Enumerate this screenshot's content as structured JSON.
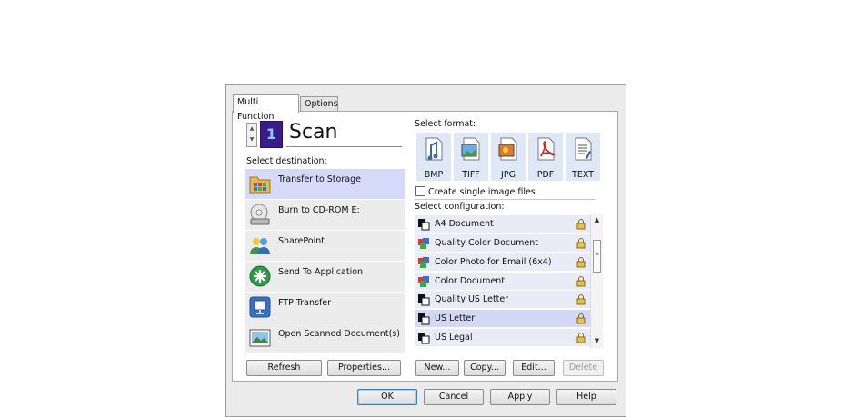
{
  "tabs": [
    {
      "label": "Multi Function"
    },
    {
      "label": "Options"
    }
  ],
  "scan": {
    "counter": "1",
    "title": "Scan"
  },
  "destination": {
    "label": "Select destination:",
    "items": [
      {
        "label": "Transfer to Storage",
        "icon": "folder-storage-icon",
        "selected": true
      },
      {
        "label": "Burn to CD-ROM  E:",
        "icon": "cd-drive-icon",
        "selected": false
      },
      {
        "label": "SharePoint",
        "icon": "sharepoint-icon",
        "selected": false
      },
      {
        "label": "Send To Application",
        "icon": "send-application-icon",
        "selected": false
      },
      {
        "label": "FTP Transfer",
        "icon": "ftp-icon",
        "selected": false
      },
      {
        "label": "Open Scanned Document(s)",
        "icon": "open-document-icon",
        "selected": false
      }
    ],
    "buttons": {
      "refresh": "Refresh",
      "properties": "Properties..."
    }
  },
  "format": {
    "label": "Select format:",
    "items": [
      {
        "label": "BMP",
        "icon": "bmp-icon"
      },
      {
        "label": "TIFF",
        "icon": "tiff-icon"
      },
      {
        "label": "JPG",
        "icon": "jpg-icon"
      },
      {
        "label": "PDF",
        "icon": "pdf-icon"
      },
      {
        "label": "TEXT",
        "icon": "text-icon"
      }
    ],
    "single_files_label": "Create single image files",
    "single_files_checked": false
  },
  "configuration": {
    "label": "Select configuration:",
    "items": [
      {
        "label": "A4 Document",
        "icon": "bw-document-icon",
        "selected": false
      },
      {
        "label": "Quality Color Document",
        "icon": "color-document-icon",
        "selected": false
      },
      {
        "label": "Color Photo for Email (6x4)",
        "icon": "color-document-icon",
        "selected": false
      },
      {
        "label": "Color Document",
        "icon": "color-document-icon",
        "selected": false
      },
      {
        "label": "Quality US Letter",
        "icon": "bw-document-icon",
        "selected": false
      },
      {
        "label": "US Letter",
        "icon": "bw-document-icon",
        "selected": true
      },
      {
        "label": "US Legal",
        "icon": "bw-document-icon",
        "selected": false
      }
    ],
    "buttons": {
      "new": "New...",
      "copy": "Copy...",
      "edit": "Edit...",
      "delete": "Delete"
    }
  },
  "footer": {
    "ok": "OK",
    "cancel": "Cancel",
    "apply": "Apply",
    "help": "Help"
  },
  "colors": {
    "selected_row": "#d5daf8",
    "accent_blue": "#3c7fb1",
    "lock_gold": "#d8b53a"
  }
}
